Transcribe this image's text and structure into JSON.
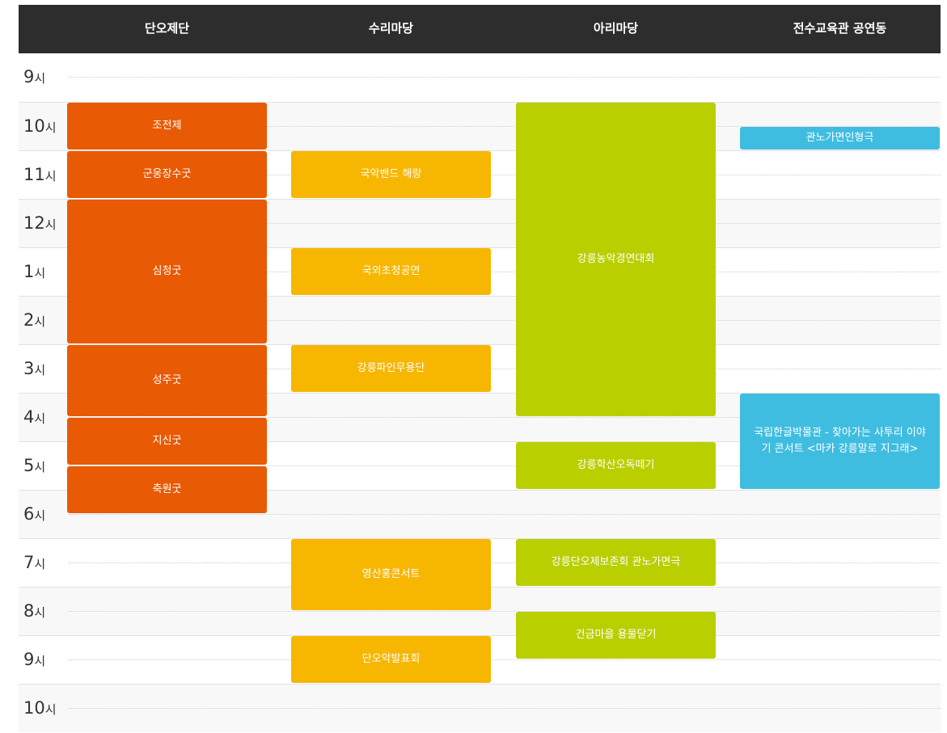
{
  "columns": [
    "단오제단",
    "수리마당",
    "아리마당",
    "전수교육관 공연동"
  ],
  "hours": [
    {
      "num": "9",
      "unit": "시"
    },
    {
      "num": "10",
      "unit": "시"
    },
    {
      "num": "11",
      "unit": "시"
    },
    {
      "num": "12",
      "unit": "시"
    },
    {
      "num": "1",
      "unit": "시"
    },
    {
      "num": "2",
      "unit": "시"
    },
    {
      "num": "3",
      "unit": "시"
    },
    {
      "num": "4",
      "unit": "시"
    },
    {
      "num": "5",
      "unit": "시"
    },
    {
      "num": "6",
      "unit": "시"
    },
    {
      "num": "7",
      "unit": "시"
    },
    {
      "num": "8",
      "unit": "시"
    },
    {
      "num": "9",
      "unit": "시"
    },
    {
      "num": "10",
      "unit": "시"
    }
  ],
  "colors": {
    "header_bg": "#2d2d2d",
    "danojedan": "#e85a04",
    "surimadang": "#f7b600",
    "arimadang": "#b9cf00",
    "jeonsu": "#3fbde0"
  },
  "events": [
    {
      "label": "조전제",
      "venue": "단오제단",
      "color_key": "danojedan",
      "start": "10:00",
      "end": "11:00"
    },
    {
      "label": "군웅장수굿",
      "venue": "단오제단",
      "color_key": "danojedan",
      "start": "11:00",
      "end": "12:00"
    },
    {
      "label": "심청굿",
      "venue": "단오제단",
      "color_key": "danojedan",
      "start": "12:00",
      "end": "15:00"
    },
    {
      "label": "성주굿",
      "venue": "단오제단",
      "color_key": "danojedan",
      "start": "15:00",
      "end": "16:30"
    },
    {
      "label": "지신굿",
      "venue": "단오제단",
      "color_key": "danojedan",
      "start": "16:30",
      "end": "17:30"
    },
    {
      "label": "축원굿",
      "venue": "단오제단",
      "color_key": "danojedan",
      "start": "17:30",
      "end": "18:30"
    },
    {
      "label": "국악밴드 해랑",
      "venue": "수리마당",
      "color_key": "surimadang",
      "start": "11:00",
      "end": "12:00"
    },
    {
      "label": "국외초청공연",
      "venue": "수리마당",
      "color_key": "surimadang",
      "start": "13:00",
      "end": "14:00"
    },
    {
      "label": "강릉파인무용단",
      "venue": "수리마당",
      "color_key": "surimadang",
      "start": "15:00",
      "end": "16:00"
    },
    {
      "label": "영산홍콘서트",
      "venue": "수리마당",
      "color_key": "surimadang",
      "start": "19:00",
      "end": "20:30"
    },
    {
      "label": "단오악발표회",
      "venue": "수리마당",
      "color_key": "surimadang",
      "start": "21:00",
      "end": "22:00"
    },
    {
      "label": "강릉농악경연대회",
      "venue": "아리마당",
      "color_key": "arimadang",
      "start": "10:00",
      "end": "16:30"
    },
    {
      "label": "강릉학산오독떼기",
      "venue": "아리마당",
      "color_key": "arimadang",
      "start": "17:00",
      "end": "18:00"
    },
    {
      "label": "강릉단오제보존회 관노가면극",
      "venue": "아리마당",
      "color_key": "arimadang",
      "start": "19:00",
      "end": "20:00"
    },
    {
      "label": "건금마을 용물닫기",
      "venue": "아리마당",
      "color_key": "arimadang",
      "start": "20:30",
      "end": "21:30"
    },
    {
      "label": "관노가면인형극",
      "venue": "전수교육관 공연동",
      "color_key": "jeonsu",
      "start": "10:30",
      "end": "11:00"
    },
    {
      "label": "국립한글박물관 - 찾아가는 사투리 이야기 콘서트 <마카 강릉말로 지그래>",
      "venue": "전수교육관 공연동",
      "color_key": "jeonsu",
      "start": "16:00",
      "end": "18:00"
    }
  ]
}
